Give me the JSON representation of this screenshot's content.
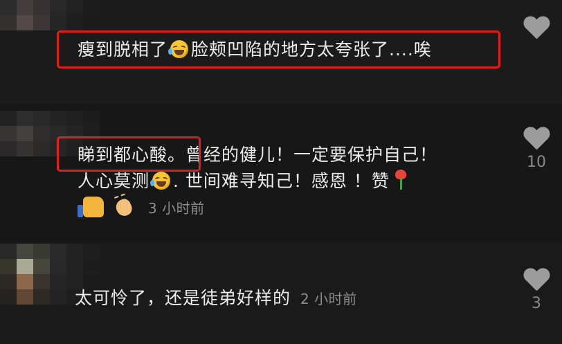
{
  "comments": [
    {
      "text_before": "瘦到脱相了",
      "text_after": "脸颊凹陷的地方太夸张了....唉",
      "time": "",
      "likes": ""
    },
    {
      "line1_highlight": "睇到都心酸。",
      "line1_rest": "曾经的健儿！一定要保护自己！",
      "line2_a": "人心莫测",
      "line2_b": ". 世间难寻知己！感恩 ！赞",
      "time": "3 小时前",
      "likes": "10"
    },
    {
      "text": "太可怜了，还是徒弟好样的",
      "time": "2 小时前",
      "likes": "3"
    }
  ],
  "icons": {
    "emoji": "rofl-emoji-icon",
    "rose": "rose-icon",
    "thumb": "thumbs-up-icon",
    "clap": "clap-icon",
    "like": "heart-icon"
  },
  "colors": {
    "background": "#161616",
    "highlight": "#e21f1f",
    "text": "#ececec",
    "muted": "#8d8d8d"
  }
}
